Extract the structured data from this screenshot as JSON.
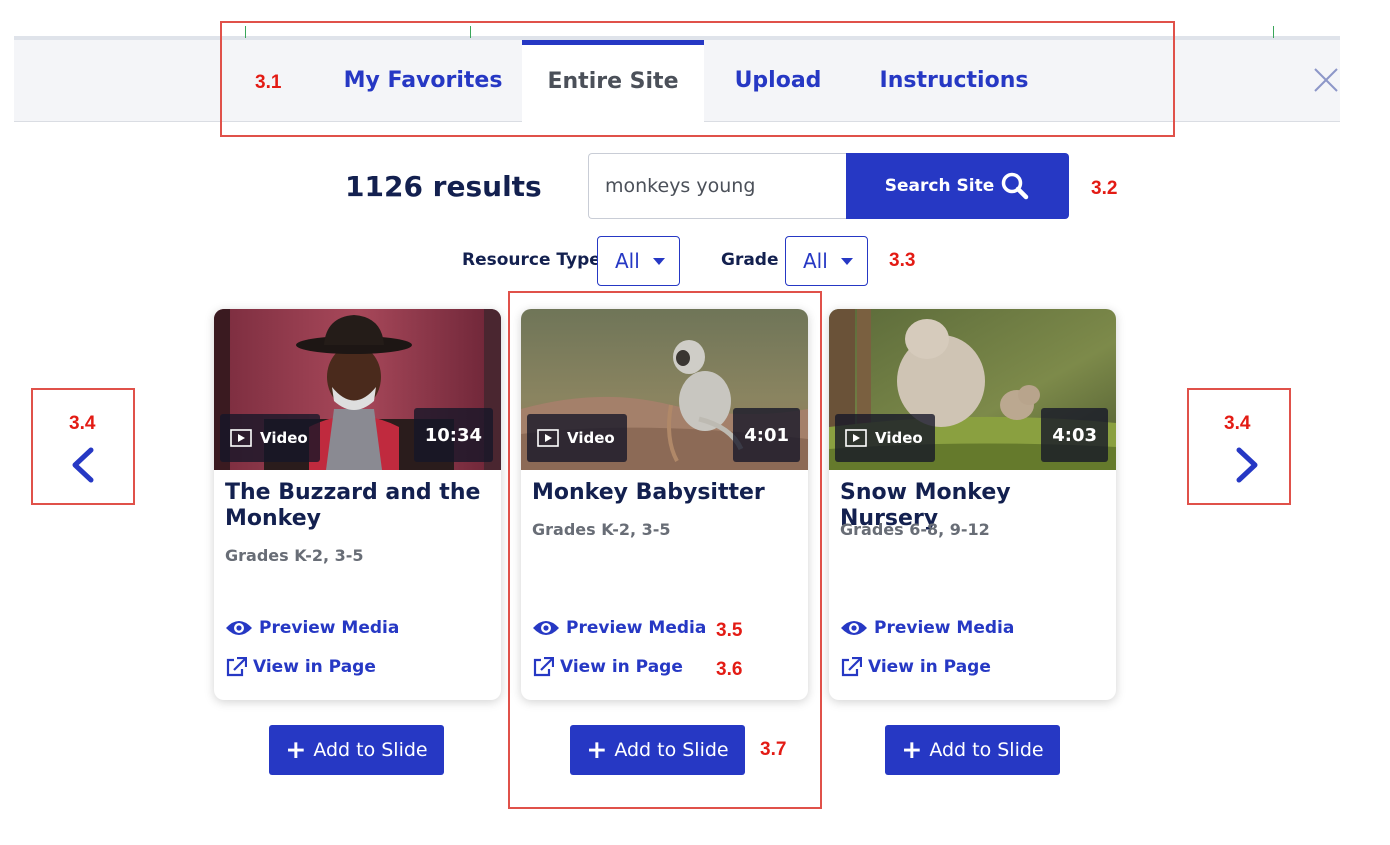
{
  "tabs": [
    {
      "label": "My Favorites",
      "active": false
    },
    {
      "label": "Entire Site",
      "active": true
    },
    {
      "label": "Upload",
      "active": false
    },
    {
      "label": "Instructions",
      "active": false
    }
  ],
  "close_icon": "close-icon",
  "search": {
    "results_text": "1126 results",
    "query": "monkeys young",
    "button_label": "Search Site",
    "button_icon": "search-icon"
  },
  "filters": {
    "resource_type": {
      "label": "Resource Type",
      "value": "All"
    },
    "grade": {
      "label": "Grade",
      "value": "All"
    }
  },
  "cards": [
    {
      "title": "The Buzzard and the Monkey",
      "type": "Video",
      "duration": "10:34",
      "grades": "Grades K-2, 3-5",
      "preview_label": "Preview Media",
      "view_label": "View in Page",
      "add_label": "Add to Slide"
    },
    {
      "title": "Monkey Babysitter",
      "type": "Video",
      "duration": "4:01",
      "grades": "Grades K-2, 3-5",
      "preview_label": "Preview Media",
      "view_label": "View in Page",
      "add_label": "Add to Slide"
    },
    {
      "title": "Snow Monkey Nursery",
      "type": "Video",
      "duration": "4:03",
      "grades": "Grades 6-8, 9-12",
      "preview_label": "Preview Media",
      "view_label": "View in Page",
      "add_label": "Add to Slide"
    }
  ],
  "annotations": {
    "tabs": "3.1",
    "search": "3.2",
    "filters": "3.3",
    "prev_arrow": "3.4",
    "next_arrow": "3.4",
    "preview": "3.5",
    "view": "3.6",
    "add": "3.7"
  },
  "colors": {
    "brand_blue": "#2638c4",
    "heading_navy": "#13204f",
    "annotation_red": "#e31b14"
  }
}
